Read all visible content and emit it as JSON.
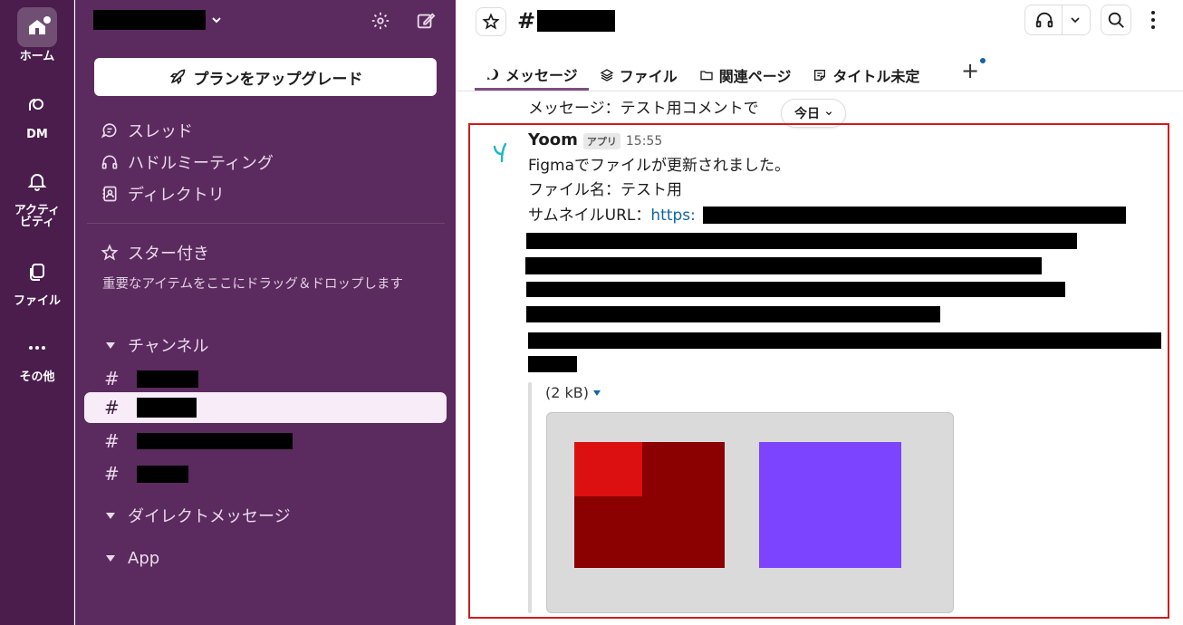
{
  "rail": {
    "items": [
      {
        "label": "ホーム",
        "icon": "home-icon"
      },
      {
        "label": "DM",
        "icon": "dm-icon"
      },
      {
        "label": "アクティ\nビティ",
        "icon": "bell-icon"
      },
      {
        "label": "ファイル",
        "icon": "files-icon"
      },
      {
        "label": "その他",
        "icon": "more-icon"
      }
    ]
  },
  "sidebar": {
    "upgrade_label": "プランをアップグレード",
    "nav": [
      {
        "label": "スレッド",
        "icon": "threads-icon"
      },
      {
        "label": "ハドルミーティング",
        "icon": "headphones-icon"
      },
      {
        "label": "ディレクトリ",
        "icon": "directory-icon"
      }
    ],
    "starred": {
      "label": "スター付き",
      "help": "重要なアイテムをここにドラッグ＆ドロップします"
    },
    "channels_label": "チャンネル",
    "channels": [
      {
        "hash": "#"
      },
      {
        "hash": "#"
      },
      {
        "hash": "#"
      },
      {
        "hash": "#"
      }
    ],
    "dm_label": "ダイレクトメッセージ",
    "app_label": "App"
  },
  "header": {
    "hash": "#",
    "tabs": [
      {
        "label": "メッセージ",
        "icon": "message-icon"
      },
      {
        "label": "ファイル",
        "icon": "layers-icon"
      },
      {
        "label": "関連ページ",
        "icon": "folder-icon"
      },
      {
        "label": "タイトル未定",
        "icon": "canvas-icon"
      }
    ],
    "add_tab": "+"
  },
  "messages": {
    "previous_text": "メッセージ：テスト用コメントで",
    "day_divider": "今日",
    "sender": "Yoom",
    "badge": "アプリ",
    "time": "15:55",
    "line1": "Figmaでファイルが更新されました。",
    "line2": "ファイル名：テスト用",
    "line3_prefix": "サムネイルURL：",
    "line3_link": "https:",
    "attachment_size": "(2 kB)"
  },
  "colors": {
    "rail_bg": "#4a1d4d",
    "sidebar_bg": "#5b2a5f",
    "highlight_border": "#d01c1c",
    "link": "#1264a3",
    "thumb_dark_red": "#8b0000",
    "thumb_red": "#dc1010",
    "thumb_purple": "#7c44ff"
  }
}
